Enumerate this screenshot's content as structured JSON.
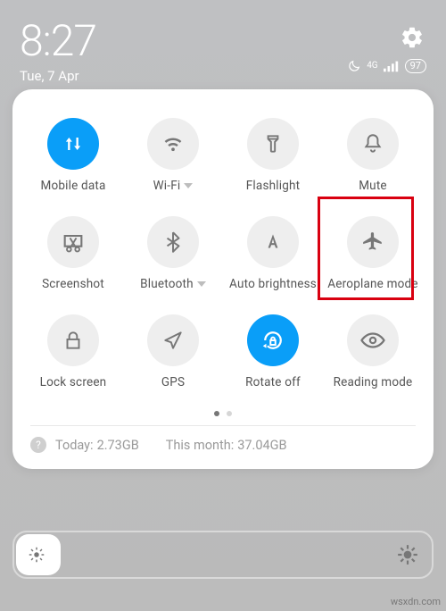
{
  "status": {
    "time": "8:27",
    "date": "Tue, 7 Apr",
    "network_label": "4G",
    "battery_text": "97"
  },
  "tiles": {
    "mobile_data": "Mobile data",
    "wifi": "Wi-Fi",
    "flashlight": "Flashlight",
    "mute": "Mute",
    "screenshot": "Screenshot",
    "bluetooth": "Bluetooth",
    "auto_brightness": "Auto brightness",
    "aeroplane": "Aeroplane mode",
    "lock_screen": "Lock screen",
    "gps": "GPS",
    "rotate_off": "Rotate off",
    "reading_mode": "Reading mode"
  },
  "data_usage": {
    "today_label": "Today:",
    "today_value": "2.73GB",
    "month_label": "This month:",
    "month_value": "37.04GB"
  },
  "watermark": "wsxdn.com"
}
